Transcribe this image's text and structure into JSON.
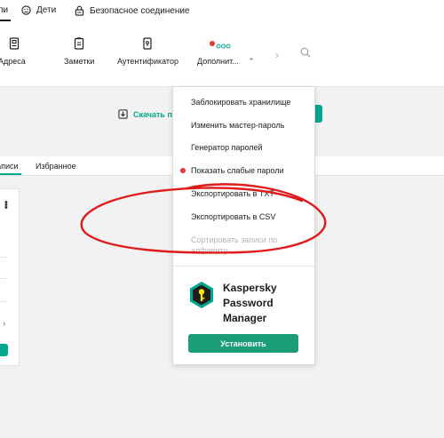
{
  "topbar": {
    "active_tab_fragment": "Пароли",
    "children_label": "Дети",
    "secure_connection_label": "Безопасное соединение"
  },
  "toolbar": {
    "addresses_label": "Адреса",
    "notes_label": "Заметки",
    "authenticator_label": "Аутентификатор",
    "more_label": "Дополнит..."
  },
  "content": {
    "download_link": "Скачать п",
    "tabs": {
      "all_records_fragment": "записи",
      "favorites": "Избранное"
    }
  },
  "menu": {
    "items": [
      {
        "label": "Заблокировать хранилище",
        "flag": false,
        "disabled": false
      },
      {
        "label": "Изменить мастер-пароль",
        "flag": false,
        "disabled": false
      },
      {
        "label": "Генератор паролей",
        "flag": false,
        "disabled": false
      },
      {
        "label": "Показать слабые пароли",
        "flag": true,
        "disabled": false
      },
      {
        "label": "Экспортировать в TXT",
        "flag": false,
        "disabled": false
      },
      {
        "label": "Экспортировать в CSV",
        "flag": false,
        "disabled": false
      },
      {
        "label": "Сортировать записи по алфавиту",
        "flag": false,
        "disabled": true
      }
    ],
    "promo": {
      "title_lines": [
        "Kaspersky",
        "Password",
        "Manager"
      ],
      "install_label": "Установить"
    }
  },
  "colors": {
    "accent": "#00a88e",
    "install_button": "#1b9e77",
    "alert_dot": "#e53935",
    "annotation_stroke": "#e01b1b",
    "logo_green": "#00a88e"
  },
  "icons": {
    "children": "smile-icon",
    "secure_connection": "lock-icon",
    "addresses": "building-icon",
    "notes": "note-icon",
    "authenticator": "phone-key-icon",
    "more": "dots-icon",
    "search": "search-icon"
  }
}
